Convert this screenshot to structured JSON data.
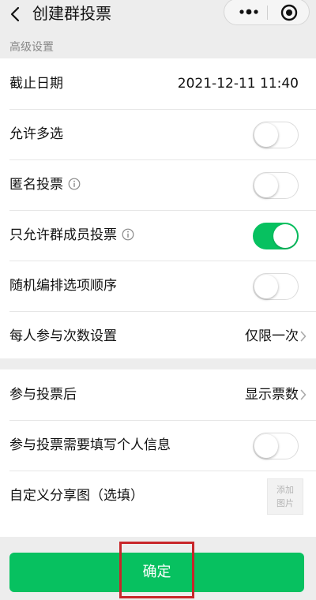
{
  "navbar": {
    "title": "创建群投票",
    "back_icon": "chevron-left-icon",
    "more_icon": "more-dots-icon",
    "close_icon": "record-target-icon"
  },
  "section": {
    "advanced_header": "高级设置"
  },
  "settings": [
    {
      "label": "截止日期",
      "value": "2021-12-11   11:40"
    },
    {
      "label": "允许多选",
      "toggle": false
    },
    {
      "label": "匿名投票",
      "info_icon": true,
      "toggle": false
    },
    {
      "label": "只允许群成员投票",
      "info_icon": true,
      "toggle": true
    },
    {
      "label": "随机编排选项顺序",
      "toggle": false
    },
    {
      "label": "每人参与次数设置",
      "value": "仅限一次"
    }
  ],
  "after_vote": [
    {
      "label": "参与投票后",
      "value": "显示票数"
    },
    {
      "label": "参与投票需要填写个人信息",
      "toggle": false
    },
    {
      "label": "自定义分享图（选填）",
      "add_image_line1": "添加",
      "add_image_line2": "图片"
    }
  ],
  "confirm_button": {
    "label": "确定"
  },
  "colors": {
    "accent": "#07c160",
    "highlight": "#c8262a",
    "background": "#ededed"
  }
}
